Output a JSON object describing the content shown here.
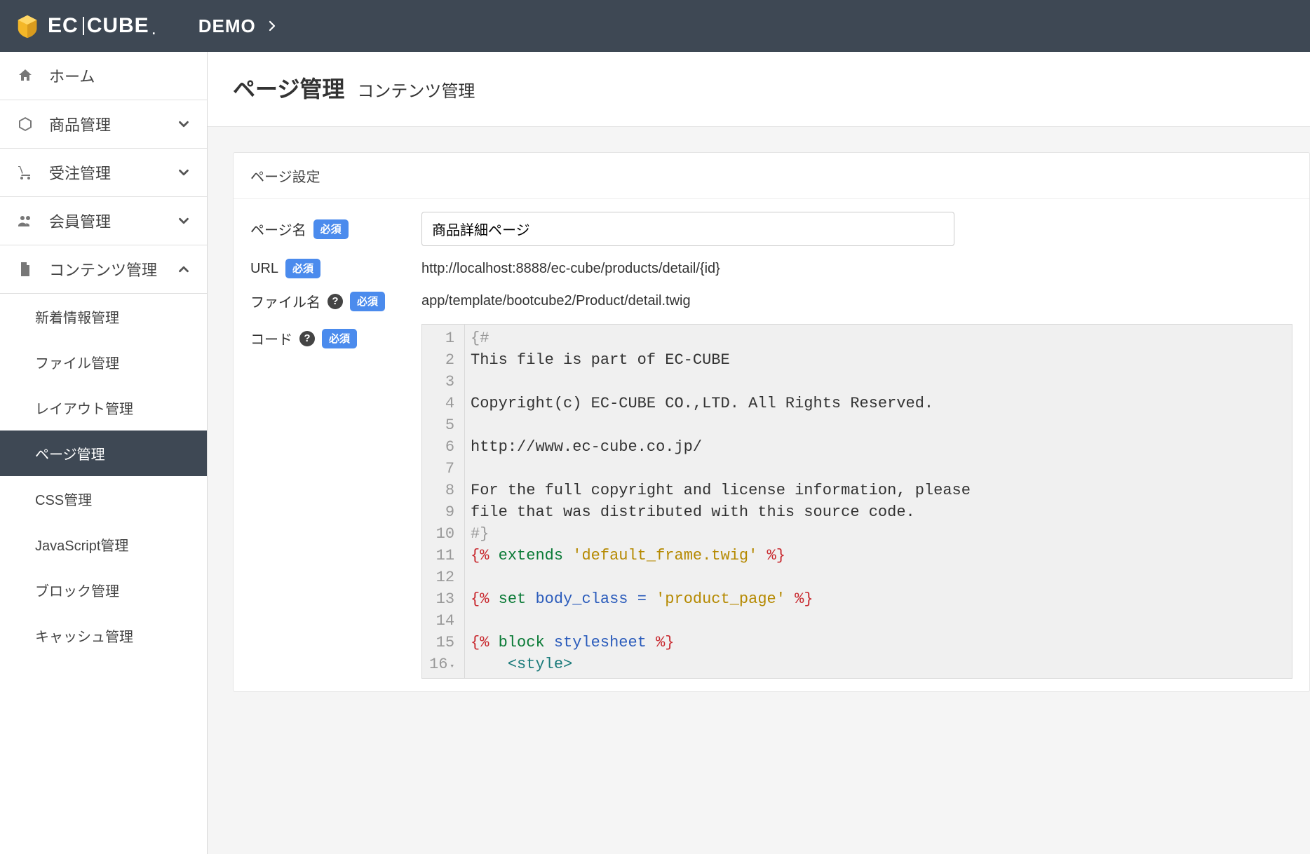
{
  "header": {
    "brand_a": "EC",
    "brand_b": "CUBE",
    "demo": "DEMO"
  },
  "sidebar": {
    "home": "ホーム",
    "products": "商品管理",
    "orders": "受注管理",
    "members": "会員管理",
    "contents": "コンテンツ管理",
    "sub": {
      "news": "新着情報管理",
      "files": "ファイル管理",
      "layout": "レイアウト管理",
      "pages": "ページ管理",
      "css": "CSS管理",
      "js": "JavaScript管理",
      "blocks": "ブロック管理",
      "cache": "キャッシュ管理"
    }
  },
  "title": {
    "main": "ページ管理",
    "sub": "コンテンツ管理"
  },
  "card": {
    "header": "ページ設定",
    "labels": {
      "page_name": "ページ名",
      "url": "URL",
      "file_name": "ファイル名",
      "code": "コード",
      "required": "必須"
    },
    "values": {
      "page_name": "商品詳細ページ",
      "url": "http://localhost:8888/ec-cube/products/detail/{id}",
      "file_name": "app/template/bootcube2/Product/detail.twig"
    },
    "code_lines": [
      [
        {
          "t": "{#",
          "c": "comment"
        }
      ],
      [
        {
          "t": "This file is part of EC-CUBE",
          "c": "plain"
        }
      ],
      [
        {
          "t": "",
          "c": "plain"
        }
      ],
      [
        {
          "t": "Copyright(c) EC-CUBE CO.,LTD. All Rights Reserved.",
          "c": "plain"
        }
      ],
      [
        {
          "t": "",
          "c": "plain"
        }
      ],
      [
        {
          "t": "http://www.ec-cube.co.jp/",
          "c": "plain"
        }
      ],
      [
        {
          "t": "",
          "c": "plain"
        }
      ],
      [
        {
          "t": "For the full copyright and license information, please",
          "c": "plain"
        }
      ],
      [
        {
          "t": "file that was distributed with this source code.",
          "c": "plain"
        }
      ],
      [
        {
          "t": "#}",
          "c": "comment"
        }
      ],
      [
        {
          "t": "{% ",
          "c": "tag"
        },
        {
          "t": "extends",
          "c": "kw"
        },
        {
          "t": " ",
          "c": "plain"
        },
        {
          "t": "'default_frame.twig'",
          "c": "str"
        },
        {
          "t": " %}",
          "c": "tag"
        }
      ],
      [
        {
          "t": "",
          "c": "plain"
        }
      ],
      [
        {
          "t": "{% ",
          "c": "tag"
        },
        {
          "t": "set",
          "c": "kw"
        },
        {
          "t": " ",
          "c": "plain"
        },
        {
          "t": "body_class",
          "c": "var"
        },
        {
          "t": " ",
          "c": "plain"
        },
        {
          "t": "=",
          "c": "op"
        },
        {
          "t": " ",
          "c": "plain"
        },
        {
          "t": "'product_page'",
          "c": "str"
        },
        {
          "t": " %}",
          "c": "tag"
        }
      ],
      [
        {
          "t": "",
          "c": "plain"
        }
      ],
      [
        {
          "t": "{% ",
          "c": "tag"
        },
        {
          "t": "block",
          "c": "kw"
        },
        {
          "t": " ",
          "c": "plain"
        },
        {
          "t": "stylesheet",
          "c": "var"
        },
        {
          "t": " %}",
          "c": "tag"
        }
      ],
      [
        {
          "t": "    ",
          "c": "plain"
        },
        {
          "t": "<style>",
          "c": "html"
        }
      ]
    ]
  }
}
